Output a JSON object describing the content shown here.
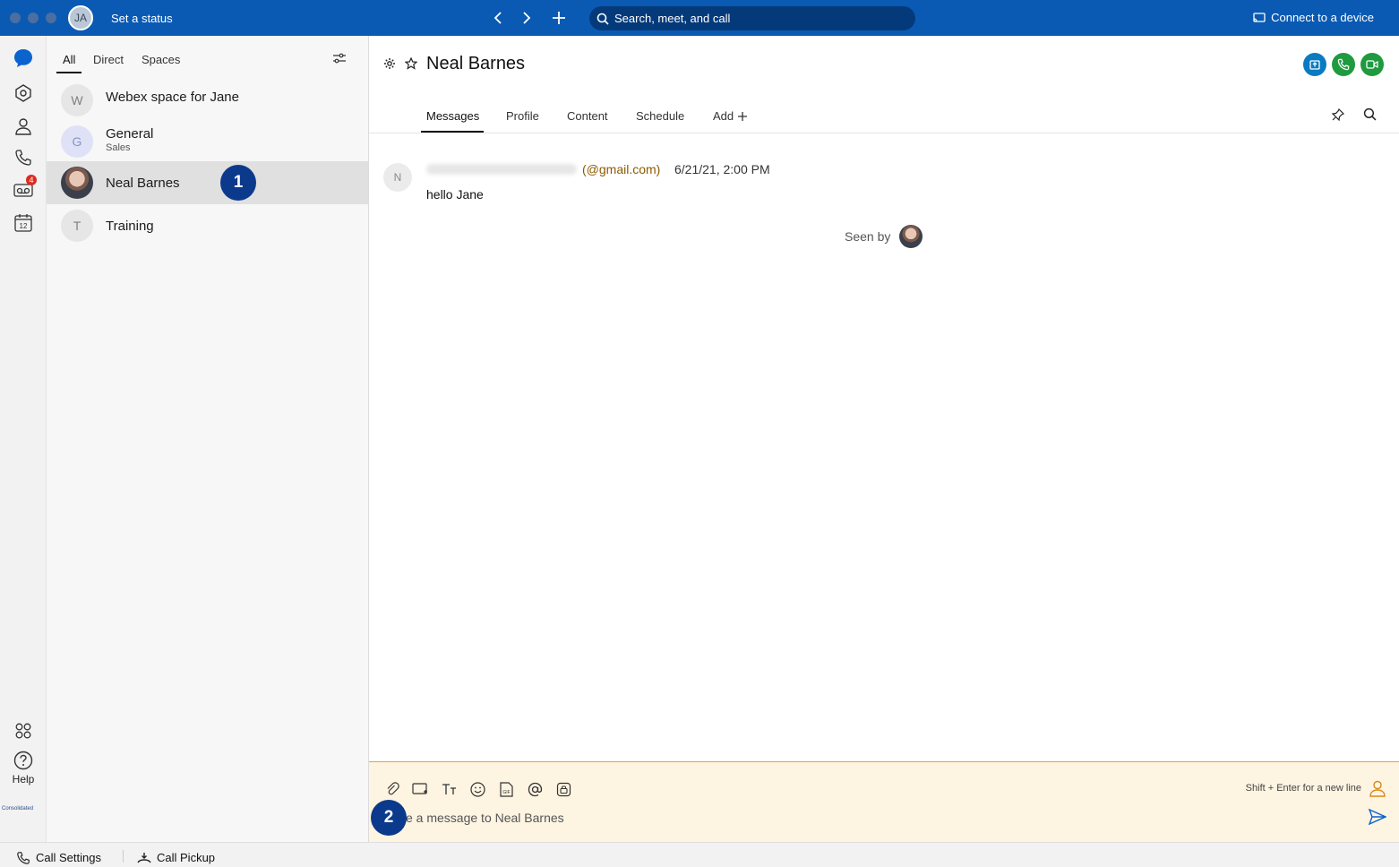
{
  "topbar": {
    "avatar_initials": "JA",
    "status": "Set a status",
    "search_placeholder": "Search, meet, and call",
    "connect_label": "Connect to a device",
    "color": "#0a5ab4"
  },
  "rail": {
    "voicemail_badge": "4",
    "calendar_day": "12",
    "help_label": "Help",
    "brand_text": "Consolidated"
  },
  "list": {
    "filters": [
      "All",
      "Direct",
      "Spaces"
    ],
    "items": [
      {
        "initial": "W",
        "name": "Webex space for Jane",
        "sub": ""
      },
      {
        "initial": "G",
        "name": "General",
        "sub": "Sales"
      },
      {
        "initial": "",
        "name": "Neal Barnes",
        "sub": ""
      },
      {
        "initial": "T",
        "name": "Training",
        "sub": ""
      }
    ]
  },
  "annotations": {
    "step1": "1",
    "step2": "2"
  },
  "conversation": {
    "title": "Neal Barnes",
    "tabs": [
      "Messages",
      "Profile",
      "Content",
      "Schedule",
      "Add"
    ],
    "message": {
      "avatar_initial": "N",
      "sender_domain": "(@gmail.com)",
      "time": "6/21/21, 2:00 PM",
      "text": "hello Jane"
    },
    "seen_by": "Seen by"
  },
  "composer": {
    "hint": "Shift + Enter for a new line",
    "placeholder": "e a message to Neal Barnes"
  },
  "bottombar": {
    "call_settings": "Call Settings",
    "call_pickup": "Call Pickup"
  }
}
